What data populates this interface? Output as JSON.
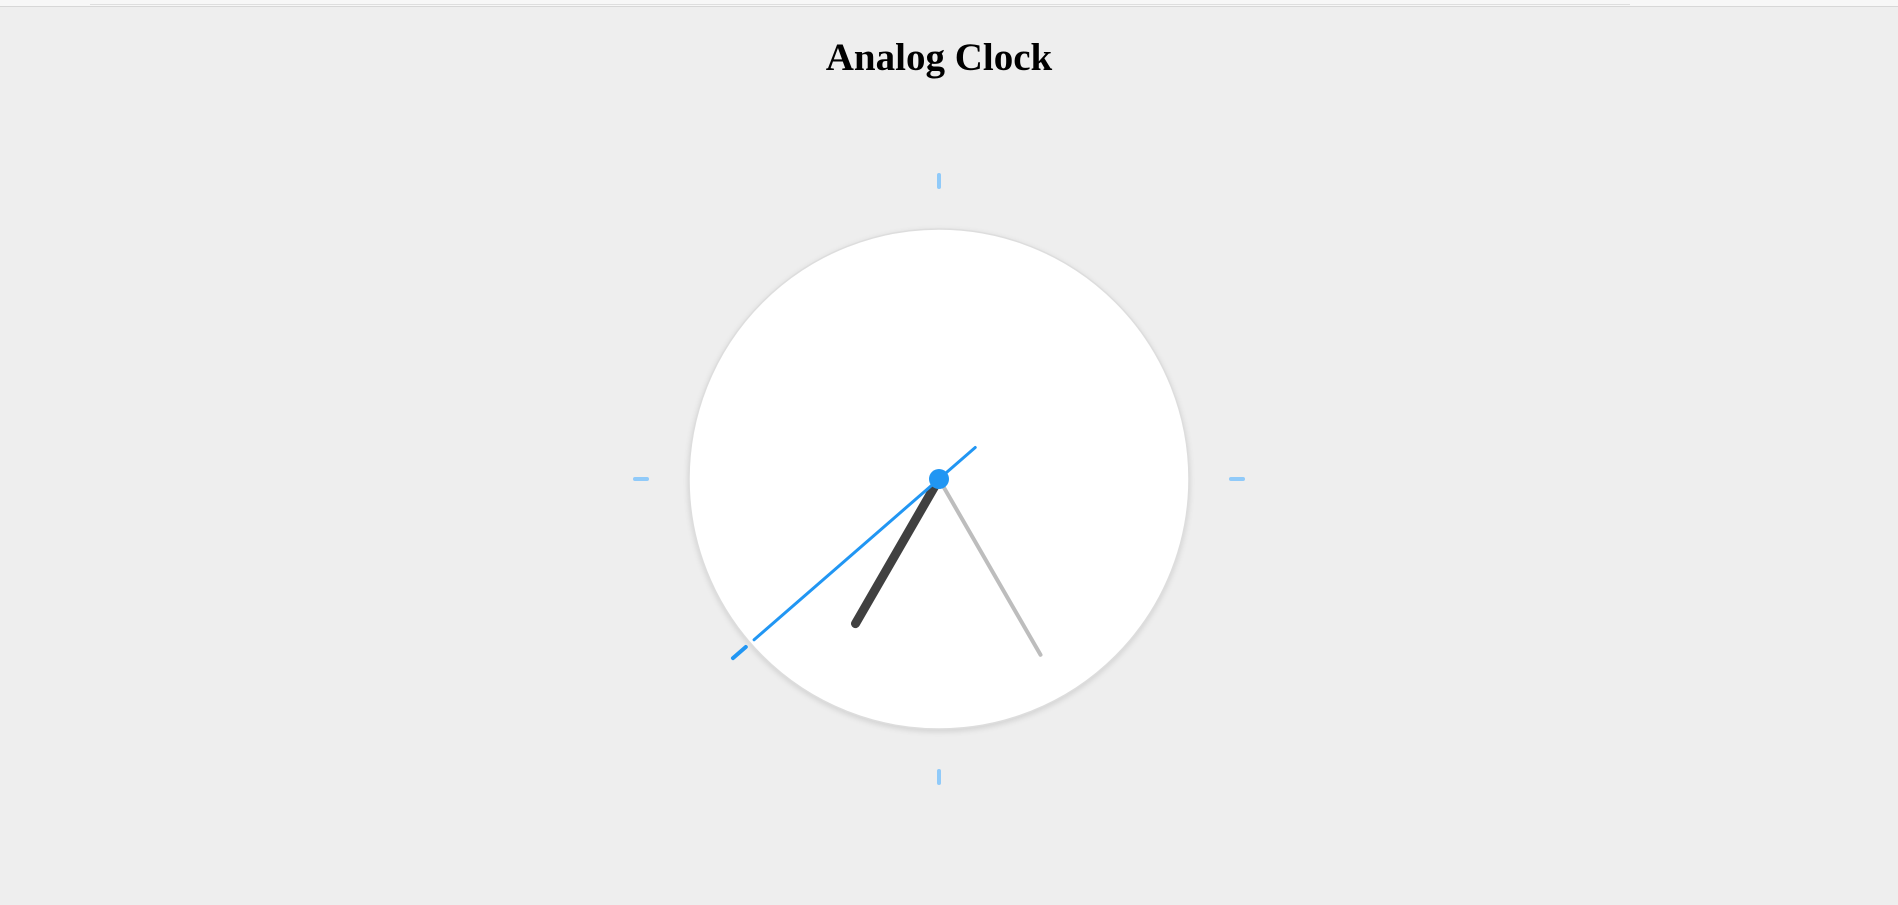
{
  "page": {
    "title": "Analog Clock"
  },
  "clock": {
    "hour_angle_deg": 210,
    "minute_angle_deg": 150,
    "second_angle_deg": 229,
    "colors": {
      "face": "#ffffff",
      "page_background": "#eeeeee",
      "tick": "#90caf9",
      "hour_hand": "#404040",
      "minute_hand": "#bdbdbd",
      "second_hand": "#2196f3",
      "center_cap": "#2196f3"
    },
    "tick_positions": [
      "12",
      "3",
      "6",
      "9"
    ]
  }
}
